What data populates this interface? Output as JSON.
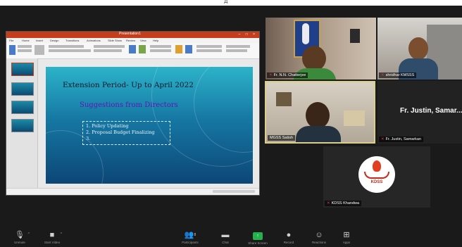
{
  "top_marker": "д",
  "ppt": {
    "title": "Presentation1",
    "window_controls": "– □ ×",
    "tabs": [
      "File",
      "Home",
      "Insert",
      "Design",
      "Transitions",
      "Animations",
      "Slide Show",
      "Review",
      "View",
      "Help"
    ],
    "slide": {
      "title": "Extension Period- Up to April 2022",
      "subtitle": "Suggestions from Directors",
      "list": [
        "1.  Policy Updating",
        "2.  Proposal Budget Finalizing",
        "3."
      ]
    }
  },
  "participants": {
    "p1": {
      "name": "Fr. N.N. Chatterjee"
    },
    "p2": {
      "name": "shridhar KMSSS"
    },
    "p3": {
      "name": "MGSS Satish"
    },
    "p4": {
      "name": "Fr. Justin, Samarkan",
      "display_name": "Fr. Justin, Samar..."
    },
    "p5": {
      "name": "KDSS Khandwa",
      "logo_text": "KDSS"
    }
  },
  "toolbar": {
    "unmute": {
      "label": "Unmute",
      "icon": "mic-muted-icon"
    },
    "video": {
      "label": "Start Video",
      "icon": "video-off-icon"
    },
    "participants": {
      "label": "Participants",
      "count": "8",
      "icon": "participants-icon"
    },
    "chat": {
      "label": "Chat",
      "icon": "chat-icon"
    },
    "share": {
      "label": "Share Screen",
      "icon": "share-screen-icon"
    },
    "record": {
      "label": "Record",
      "icon": "record-icon"
    },
    "reactions": {
      "label": "Reactions",
      "icon": "reactions-icon"
    },
    "apps": {
      "label": "Apps",
      "icon": "apps-icon"
    }
  },
  "colors": {
    "ppt_accent": "#c43e1c",
    "share_green": "#23b14d",
    "muted_red": "#e03b3b"
  }
}
